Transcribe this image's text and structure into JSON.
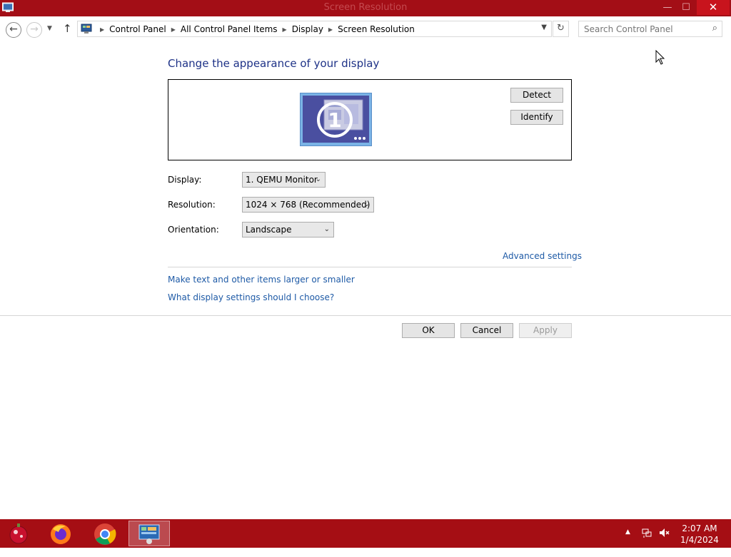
{
  "window": {
    "title": "Screen Resolution",
    "close_glyph": "✕",
    "minimize_glyph": "—",
    "maximize_glyph": "☐"
  },
  "nav": {
    "breadcrumbs": [
      "Control Panel",
      "All Control Panel Items",
      "Display",
      "Screen Resolution"
    ],
    "search_placeholder": "Search Control Panel"
  },
  "main": {
    "title": "Change the appearance of your display",
    "monitor_number": "1",
    "detect_label": "Detect",
    "identify_label": "Identify",
    "fields": {
      "display_label": "Display:",
      "display_value": "1. QEMU Monitor",
      "resolution_label": "Resolution:",
      "resolution_value": "1024 × 768 (Recommended)",
      "orientation_label": "Orientation:",
      "orientation_value": "Landscape"
    },
    "advanced_settings": "Advanced settings",
    "link_text_size": "Make text and other items larger or smaller",
    "link_display_help": "What display settings should I choose?",
    "ok_label": "OK",
    "cancel_label": "Cancel",
    "apply_label": "Apply"
  },
  "taskbar": {
    "time": "2:07 AM",
    "date": "1/4/2024",
    "items": [
      "start-icon",
      "firefox-icon",
      "chrome-icon",
      "control-panel-icon"
    ]
  },
  "colors": {
    "titlebar": "#a30e16",
    "taskbar": "#a50e14",
    "link": "#1e5aa6",
    "heading": "#1e3287"
  }
}
